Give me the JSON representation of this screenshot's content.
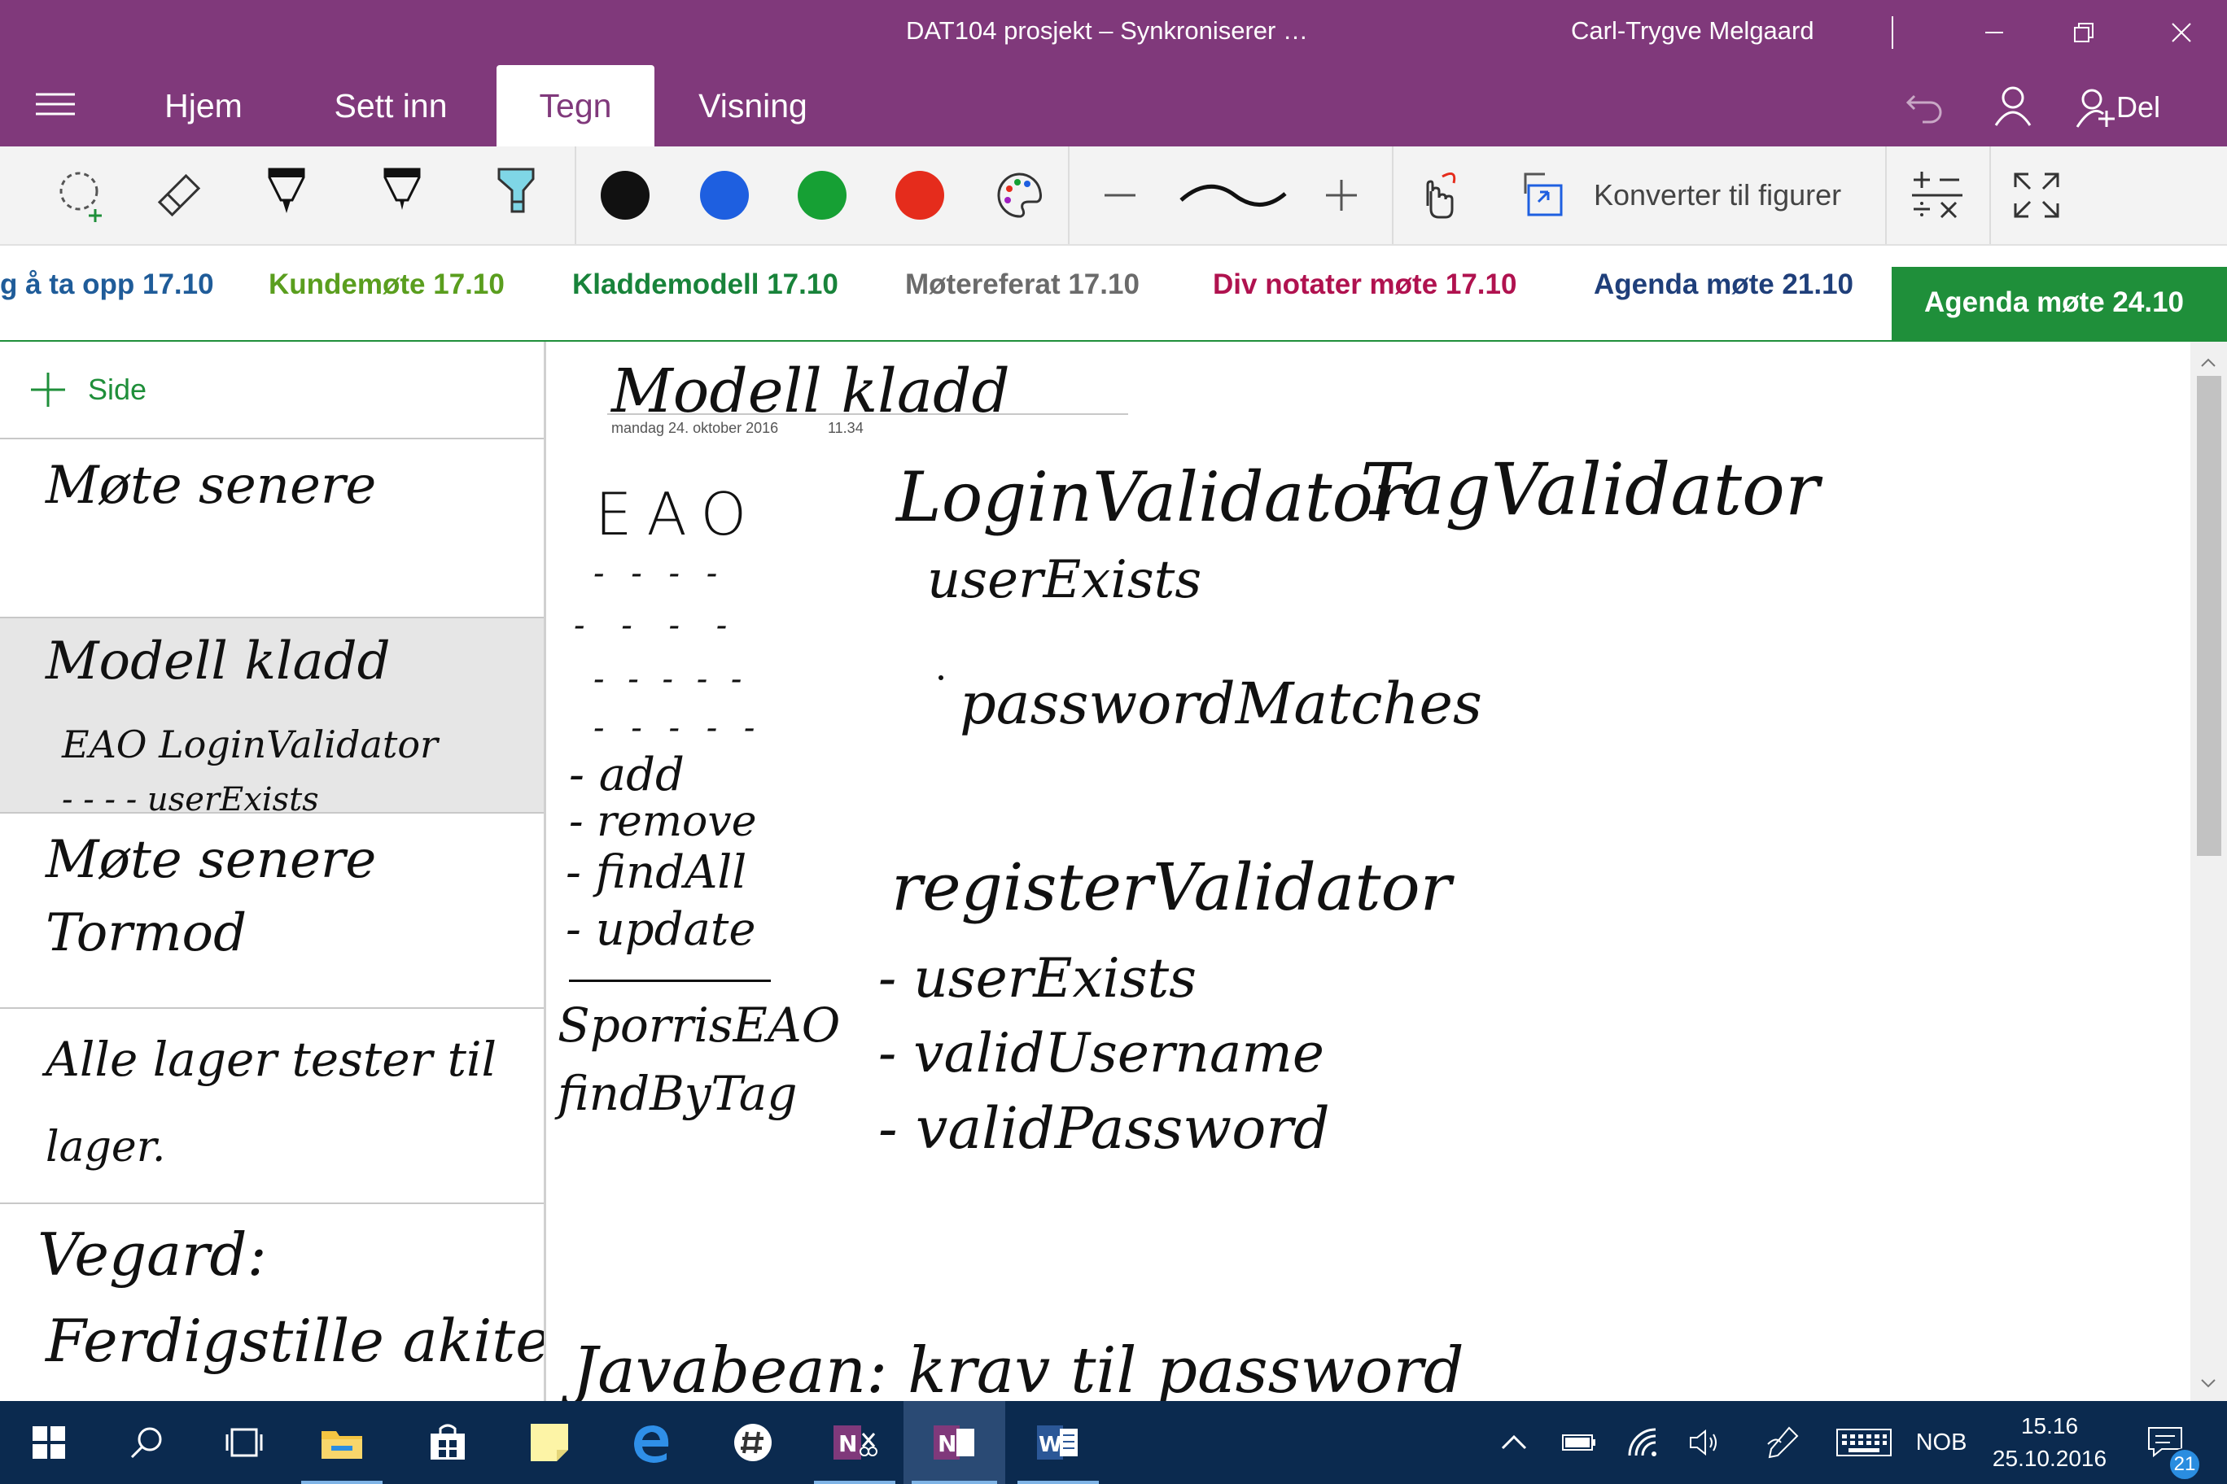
{
  "window": {
    "title": "DAT104 prosjekt – Synkroniserer …",
    "user": "Carl-Trygve Melgaard",
    "controls": [
      "minimize-icon",
      "restore-icon",
      "close-icon"
    ]
  },
  "ribbon": {
    "tabs": [
      "Hjem",
      "Sett inn",
      "Tegn",
      "Visning"
    ],
    "active_tab": "Tegn",
    "share_label": "Del"
  },
  "toolbar": {
    "colors": {
      "black": "#111111",
      "blue": "#1e5fe0",
      "green": "#16a034",
      "red": "#e52c1c"
    },
    "convert_label": "Konverter til figurer"
  },
  "sections": [
    {
      "label": "g å ta opp 17.10",
      "color": "#1f5c99"
    },
    {
      "label": "Kundemøte 17.10",
      "color": "#5a9e1e"
    },
    {
      "label": "Kladdemodell 17.10",
      "color": "#18833a"
    },
    {
      "label": "Møtereferat 17.10",
      "color": "#6b6b6b"
    },
    {
      "label": "Div notater møte 17.10",
      "color": "#b0124f"
    },
    {
      "label": "Agenda møte 21.10",
      "color": "#1f3f7a"
    },
    {
      "label": "Agenda møte 24.10",
      "color": "#ffffff",
      "bg": "#1f8f3a"
    }
  ],
  "pages_pane": {
    "add_label": "Side",
    "pages": [
      {
        "lines": [
          "Møte senere"
        ]
      },
      {
        "lines": [
          "Modell kladd",
          "EAO   LoginValidator",
          "- - - -      userExists"
        ]
      },
      {
        "lines": [
          "Møte senere",
          "Tormod"
        ]
      },
      {
        "lines": [
          "Alle lager tester til",
          "lager."
        ]
      },
      {
        "lines": [
          "Vegard:",
          "Ferdigstille akite"
        ]
      }
    ]
  },
  "canvas": {
    "page_title": "Modell kladd",
    "date": "mandag 24. oktober 2016",
    "time": "11.34",
    "ink": {
      "eao": "EAO",
      "dashes1": "- - - -",
      "dashes2": "- - - -",
      "dashes3": "- - - - -",
      "dashes4": "- - - - -",
      "add": "- add",
      "remove": "- remove",
      "findall": "- findAll",
      "update": "- update",
      "sporris": "SporrisEAO",
      "findbytag": "findByTag",
      "login_validator": "LoginValidator",
      "tag_validator": "TagValidator",
      "user_exists_1": "userExists",
      "password_matches": "passwordMatches",
      "register_validator": "registerValidator",
      "user_exists_2": "- userExists",
      "valid_username": "- validUsername",
      "valid_password": "- validPassword",
      "javabean": "Javabean: krav til password"
    }
  },
  "taskbar": {
    "language": "NOB",
    "time": "15.16",
    "date": "25.10.2016",
    "notifications": "21",
    "apps": [
      "start-icon",
      "search-icon",
      "task-view-icon",
      "file-explorer-icon",
      "store-icon",
      "sticky-notes-icon",
      "edge-icon",
      "slack-icon",
      "onenote-clipper-icon",
      "onenote-icon",
      "word-icon"
    ]
  }
}
